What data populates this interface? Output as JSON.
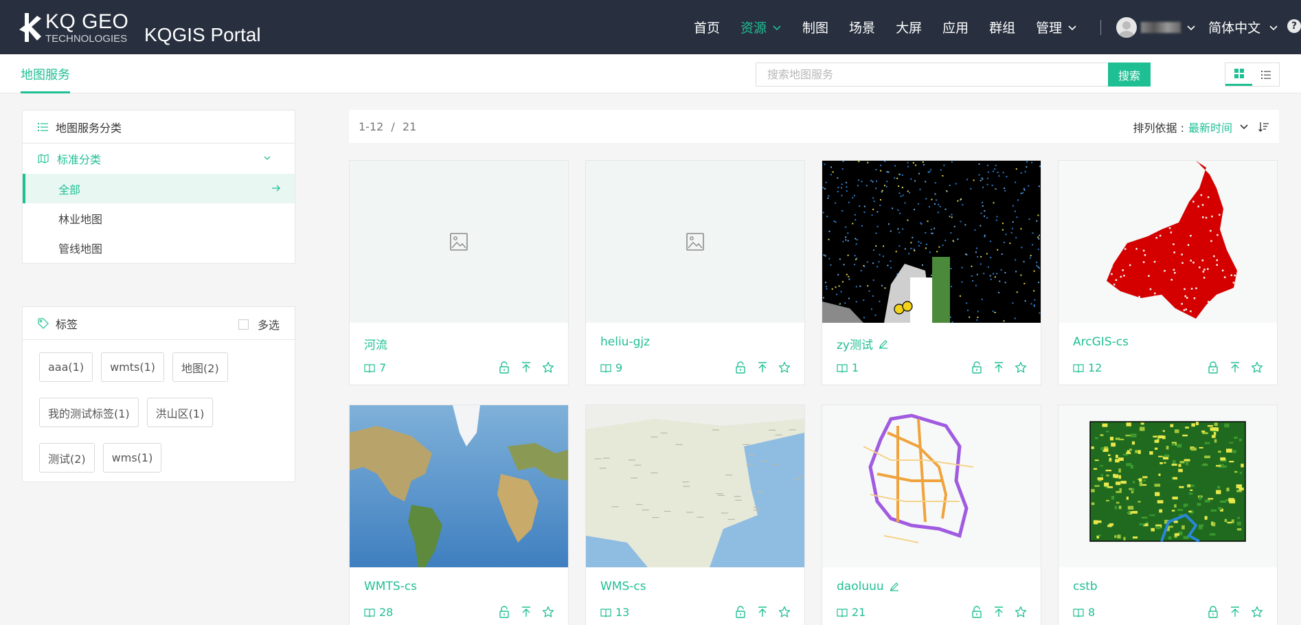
{
  "header": {
    "logo_line1": "KQ GEO",
    "logo_line2": "TECHNOLOGIES",
    "portal_name": "KQGIS Portal",
    "nav": [
      {
        "label": "首页"
      },
      {
        "label": "资源"
      },
      {
        "label": "制图"
      },
      {
        "label": "场景"
      },
      {
        "label": "大屏"
      },
      {
        "label": "应用"
      },
      {
        "label": "群组"
      },
      {
        "label": "管理"
      }
    ],
    "language": "简体中文",
    "accent": "#1fbf94",
    "bg": "#28303f"
  },
  "subbar": {
    "tab": "地图服务",
    "search_placeholder": "搜索地图服务",
    "search_button": "搜索"
  },
  "categories": {
    "title": "地图服务分类",
    "group": "标准分类",
    "items": [
      "全部",
      "林业地图",
      "管线地图"
    ]
  },
  "tags_panel": {
    "title": "标签",
    "multi": "多选",
    "tags": [
      "aaa(1)",
      "wmts(1)",
      "地图(2)",
      "我的测试标签(1)",
      "洪山区(1)",
      "测试(2)",
      "wms(1)"
    ]
  },
  "results": {
    "range": "1-12",
    "sep": "/",
    "total": "21",
    "sort_label": "排列依据 :",
    "sort_value": "最新时间"
  },
  "cards": [
    {
      "title": "河流",
      "count": "7",
      "thumb": "placeholder",
      "editable": false,
      "locked": false
    },
    {
      "title": "heliu-gjz",
      "count": "9",
      "thumb": "placeholder",
      "editable": false,
      "locked": false
    },
    {
      "title": "zy测试",
      "count": "1",
      "thumb": "night",
      "editable": true,
      "locked": false
    },
    {
      "title": "ArcGIS-cs",
      "count": "12",
      "thumb": "redmap",
      "editable": false,
      "locked": true
    },
    {
      "title": "WMTS-cs",
      "count": "28",
      "thumb": "world",
      "editable": false,
      "locked": false
    },
    {
      "title": "WMS-cs",
      "count": "13",
      "thumb": "asia",
      "editable": false,
      "locked": false
    },
    {
      "title": "daoluuu",
      "count": "21",
      "thumb": "roads",
      "editable": true,
      "locked": false
    },
    {
      "title": "cstb",
      "count": "8",
      "thumb": "landcover",
      "editable": false,
      "locked": true
    }
  ]
}
